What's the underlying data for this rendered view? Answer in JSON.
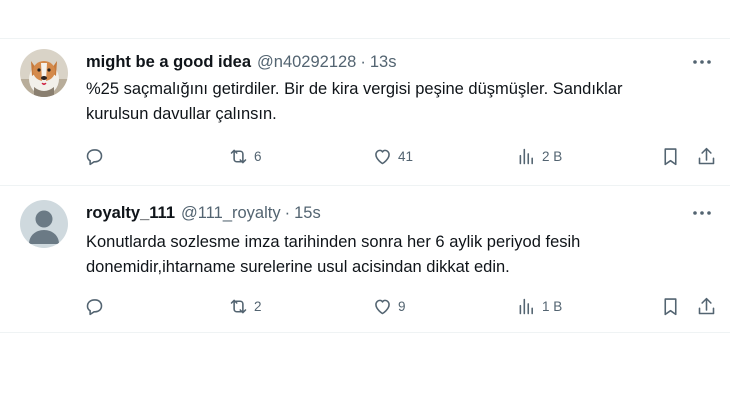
{
  "tweets": [
    {
      "name": "might be a good idea",
      "handle": "@n40292128",
      "separator": "·",
      "time": "13s",
      "text_lines": [
        "%25 saçmalığını getirdiler. Bir de kira vergisi peşine düşmüşler. Sandıklar",
        "kurulsun davullar çalınsın."
      ],
      "replies": "",
      "reposts": "6",
      "likes": "41",
      "views": "2 B",
      "avatar": "dog-photo"
    },
    {
      "name": "royalty_111",
      "handle": "@111_royalty",
      "separator": "·",
      "time": "15s",
      "text_lines": [
        "Konutlarda sozlesme imza tarihinden sonra her 6 aylik periyod fesih",
        "donemidir,ihtarname surelerine usul acisindan dikkat edin."
      ],
      "replies": "",
      "reposts": "2",
      "likes": "9",
      "views": "1 B",
      "avatar": "default-profile"
    }
  ],
  "icons": {
    "reply": "reply-icon",
    "repost": "repost-icon",
    "like": "like-icon",
    "views": "views-icon",
    "bookmark": "bookmark-icon",
    "share": "share-icon",
    "more": "more-icon"
  },
  "colors": {
    "text": "#0f1419",
    "secondary": "#536471",
    "border": "#eff3f4",
    "avatar_default": "#cfd9de"
  }
}
